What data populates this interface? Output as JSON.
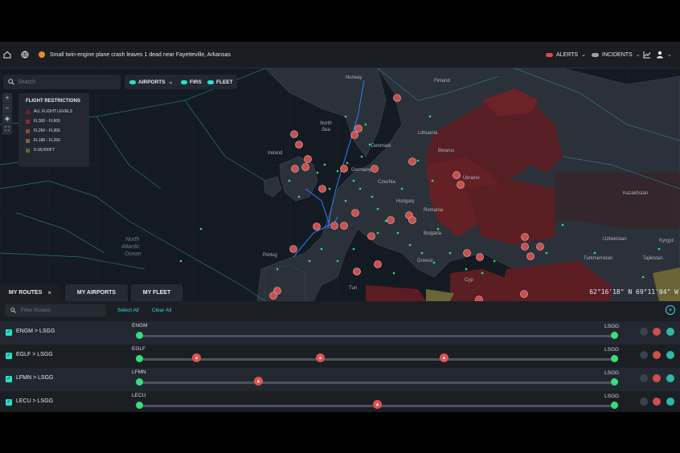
{
  "header": {
    "news": "Small twin-engine plane crash leaves 1 dead near Fayetteville, Arkansas",
    "alerts_label": "ALERTS",
    "incidents_label": "INCIDENTS",
    "icons": [
      "home-icon",
      "globe-icon",
      "alert-dot-icon",
      "chart-icon",
      "user-icon"
    ]
  },
  "map": {
    "search_placeholder": "Search",
    "layers": [
      {
        "label": "AIRPORTS",
        "has_dropdown": true
      },
      {
        "label": "FIRS"
      },
      {
        "label": "FLEET"
      }
    ],
    "zoom_controls": [
      "+",
      "−",
      "◈",
      "⛶"
    ],
    "restrictions": {
      "title": "FLIGHT RESTRICTIONS",
      "items": [
        {
          "label": "ALL FLIGHT LEVELS",
          "color": "#6b1f25"
        },
        {
          "label": "FL300 - FL600",
          "color": "#8a2a2e"
        },
        {
          "label": "FL260 - FL300",
          "color": "#8a4a3a"
        },
        {
          "label": "FL180 - FL260",
          "color": "#6e6a3a"
        },
        {
          "label": "0-18,000FT",
          "color": "#4f6a3f"
        }
      ]
    },
    "labels": {
      "norway": "Norway",
      "finland": "Finland",
      "north_sea_1": "North",
      "north_sea_2": "Sea",
      "ireland": "Ireland",
      "denmark": "Denmark",
      "lithuania": "Lithuania",
      "belarus": "Belarus",
      "germany": "Germany",
      "czechia": "Czechia",
      "ukraine": "Ukraine",
      "hungary": "Hungary",
      "romania": "Romania",
      "bulgaria": "Bulgaria",
      "greece": "Greece",
      "kazakhstan": "Kazakhstan",
      "uzbekistan": "Uzbekistan",
      "kyrgyz": "Kyrgyz",
      "turkmenistan": "Turkmenistan",
      "tajikistan": "Tajikistan",
      "portugal": "Portug",
      "atlantic_1": "North",
      "atlantic_2": "Atlantic",
      "atlantic_3": "Ocean",
      "tunisia": "Tun",
      "cyprus": "Cyp"
    },
    "coords": "62°16'18\" N 69°11'04\" W"
  },
  "tabs": [
    {
      "label": "MY ROUTES",
      "close": "×",
      "active": true
    },
    {
      "label": "MY AIRPORTS"
    },
    {
      "label": "MY FLEET"
    }
  ],
  "routes_panel": {
    "filter_placeholder": "Filter Routes",
    "select_all": "Select All",
    "clear_all": "Clear All",
    "routes": [
      {
        "name": "ENGM > LSGG",
        "origin": "ENGM",
        "destination": "LSGG",
        "checked": true,
        "alerts": []
      },
      {
        "name": "EGLF > LSGG",
        "origin": "EGLF",
        "destination": "LSGG",
        "checked": true,
        "alerts": [
          0.12,
          0.38,
          0.64
        ]
      },
      {
        "name": "LFMN > LSGG",
        "origin": "LFMN",
        "destination": "LSGG",
        "checked": true,
        "alerts": [
          0.25
        ]
      },
      {
        "name": "LECU > LSGG",
        "origin": "LECU",
        "destination": "LSGG",
        "checked": true,
        "alerts": [
          0.5
        ]
      }
    ]
  },
  "colors": {
    "accent": "#2fe0c4",
    "endpoint": "#33e07a",
    "alert": "#e25050",
    "link": "#3fd2e6"
  }
}
